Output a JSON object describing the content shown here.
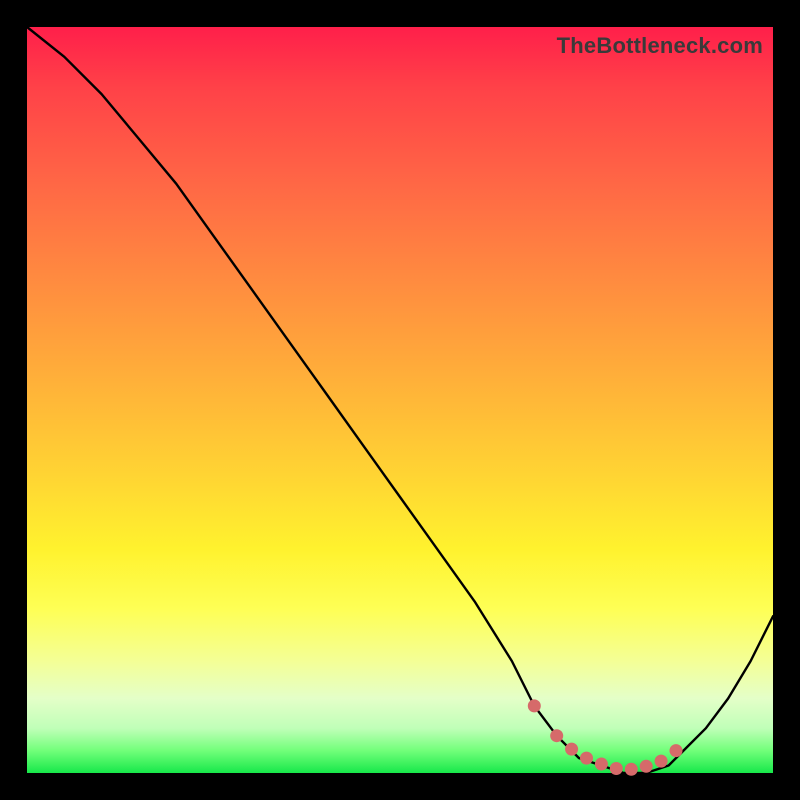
{
  "watermark": "TheBottleneck.com",
  "chart_data": {
    "type": "line",
    "title": "",
    "xlabel": "",
    "ylabel": "",
    "xlim": [
      0,
      100
    ],
    "ylim": [
      0,
      100
    ],
    "series": [
      {
        "name": "curve",
        "x": [
          0,
          5,
          10,
          15,
          20,
          25,
          30,
          35,
          40,
          45,
          50,
          55,
          60,
          65,
          68,
          71,
          74,
          77,
          80,
          83,
          86,
          88,
          91,
          94,
          97,
          100
        ],
        "values": [
          100,
          96,
          91,
          85,
          79,
          72,
          65,
          58,
          51,
          44,
          37,
          30,
          23,
          15,
          9,
          5,
          2,
          1,
          0,
          0,
          1,
          3,
          6,
          10,
          15,
          21
        ]
      }
    ],
    "highlight": {
      "name": "highlight-dots",
      "color": "#d66a6a",
      "x": [
        68,
        71,
        73,
        75,
        77,
        79,
        81,
        83,
        85,
        87
      ],
      "values": [
        9,
        5,
        3.2,
        2,
        1.2,
        0.6,
        0.5,
        0.9,
        1.6,
        3
      ]
    }
  }
}
